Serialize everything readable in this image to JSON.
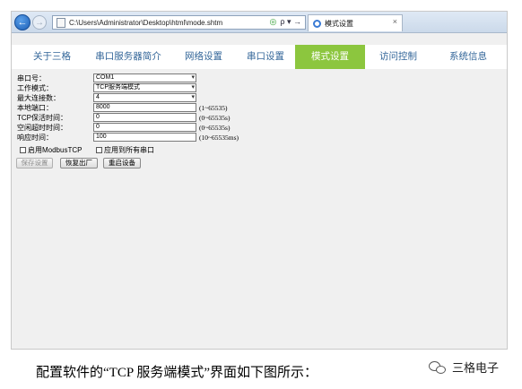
{
  "browser": {
    "address": "C:\\Users\\Administrator\\Desktop\\html\\mode.shtm",
    "address_tools": "ρ ▾ →",
    "tab_title": "模式设置",
    "tab_close": "×",
    "back_glyph": "←",
    "forward_glyph": "→"
  },
  "menu": {
    "items": [
      {
        "label": "关于三格",
        "active": false
      },
      {
        "label": "串口服务器简介",
        "active": false
      },
      {
        "label": "网络设置",
        "active": false
      },
      {
        "label": "串口设置",
        "active": false
      },
      {
        "label": "模式设置",
        "active": true
      },
      {
        "label": "访问控制",
        "active": false
      },
      {
        "label": "系统信息",
        "active": false
      }
    ],
    "active_color": "#8cc63e",
    "text_color": "#336699"
  },
  "form": {
    "serial_port": {
      "label": "串口号：",
      "value": "COM1"
    },
    "work_mode": {
      "label": "工作模式：",
      "value": "TCP服务端模式"
    },
    "max_connections": {
      "label": "最大连接数：",
      "value": "4"
    },
    "local_port": {
      "label": "本地端口：",
      "value": "8000",
      "range": "(1~65535)"
    },
    "tcp_keepalive": {
      "label": "TCP保活时间：",
      "value": "0",
      "range": "(0~65535s)"
    },
    "idle_timeout": {
      "label": "空闲超时时间：",
      "value": "0",
      "range": "(0~65535s)"
    },
    "response_time": {
      "label": "响应时间：",
      "value": "100",
      "range": "(10~65535ms)"
    },
    "enable_modbus": {
      "label": "启用ModbusTCP",
      "checked": false
    },
    "apply_all": {
      "label": "应用到所有串口",
      "checked": false
    }
  },
  "buttons": {
    "save": "保存设置",
    "restore": "恢复出厂",
    "restart": "重启设备"
  },
  "caption": "配置软件的“TCP 服务端模式”界面如下图所示：",
  "watermark": "三格电子"
}
